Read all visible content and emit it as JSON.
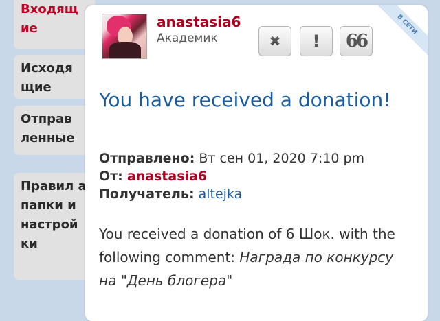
{
  "sidebar": {
    "items": [
      {
        "label": "Входящ ие"
      },
      {
        "label": "Исходя щие"
      },
      {
        "label": "Отправ ленные"
      },
      {
        "label": "Правил а, папки и настрой ки"
      }
    ]
  },
  "message": {
    "username": "anastasia6",
    "rank": "Академик",
    "status_ribbon": "В СЕТИ",
    "buttons": {
      "close": "✖",
      "report": "!",
      "quote": "66"
    },
    "title": "You have received a donation!",
    "sent_label": "Отправлено:",
    "sent_value": "Вт сен 01, 2020 7:10 pm",
    "from_label": "От:",
    "from_value": "anastasia6",
    "to_label": "Получатель:",
    "to_value": "altejka",
    "body_text": "You received a donation of 6 Шок. with the following comment:",
    "body_comment": "Награда по конкурсу на \"День блогера\""
  },
  "colors": {
    "accent_red": "#b00020",
    "link_blue": "#1b5c9e",
    "background": "#c9d8e8"
  }
}
